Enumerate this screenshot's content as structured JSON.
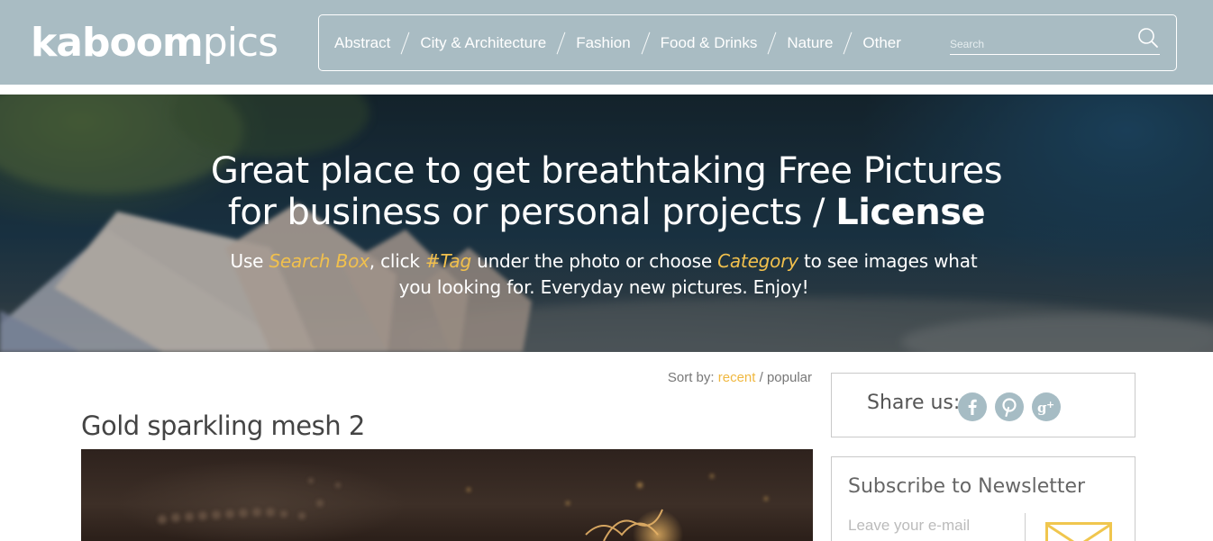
{
  "header": {
    "logo_bold": "kaboom",
    "logo_light": "pics",
    "nav": [
      "Abstract",
      "City & Architecture",
      "Fashion",
      "Food & Drinks",
      "Nature",
      "Other"
    ],
    "search_placeholder": "Search",
    "search_icon": "search-icon"
  },
  "hero": {
    "title_line1": "Great place to get breathtaking Free Pictures",
    "title_line2_pre": "for business or personal projects / ",
    "title_line2_link": "License",
    "sub_use": "Use ",
    "sub_searchbox": "Search Box",
    "sub_click": ", click ",
    "sub_tag": "#Tag",
    "sub_under": " under the photo or choose ",
    "sub_category": "Category",
    "sub_rest": " to see images what you looking for. Everyday new pictures. Enjoy!"
  },
  "sort": {
    "label": "Sort by: ",
    "active": "recent",
    "separator": " / ",
    "other": "popular"
  },
  "post": {
    "title": "Gold sparkling mesh 2"
  },
  "sidebar": {
    "share_label": "Share us:",
    "social_icons": [
      "facebook-icon",
      "pinterest-icon",
      "google-plus-icon"
    ],
    "newsletter_title": "Subscribe to Newsletter",
    "newsletter_text": "Leave your e-mail",
    "envelope_icon": "envelope-icon"
  },
  "colors": {
    "header_bg": "#a9bcc3",
    "accent": "#f1c04d",
    "social_bg": "#a6bcc4"
  }
}
